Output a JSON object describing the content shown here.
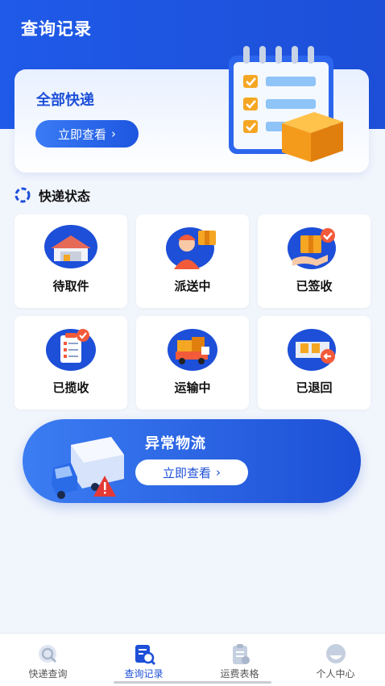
{
  "header": {
    "title": "查询记录"
  },
  "all_express": {
    "title": "全部快递",
    "button_label": "立即查看",
    "button_icon": "chevron-right-icon"
  },
  "status_section": {
    "title": "快递状态",
    "items": [
      {
        "label": "待取件",
        "icon": "warehouse-icon"
      },
      {
        "label": "派送中",
        "icon": "courier-icon"
      },
      {
        "label": "已签收",
        "icon": "package-signed-icon"
      },
      {
        "label": "已揽收",
        "icon": "clipboard-check-icon"
      },
      {
        "label": "运输中",
        "icon": "delivery-truck-icon"
      },
      {
        "label": "已退回",
        "icon": "package-return-icon"
      }
    ]
  },
  "abnormal": {
    "title": "异常物流",
    "button_label": "立即查看",
    "button_icon": "chevron-right-icon"
  },
  "tabbar": {
    "tabs": [
      {
        "label": "快递查询",
        "icon": "search-icon",
        "active": false
      },
      {
        "label": "查询记录",
        "icon": "record-search-icon",
        "active": true
      },
      {
        "label": "运费表格",
        "icon": "clipboard-form-icon",
        "active": false
      },
      {
        "label": "个人中心",
        "icon": "user-icon",
        "active": false
      }
    ]
  },
  "colors": {
    "primary": "#1d4fd8",
    "background": "#f1f5fc",
    "accent_orange": "#f5a623",
    "alert_red": "#e53935"
  }
}
